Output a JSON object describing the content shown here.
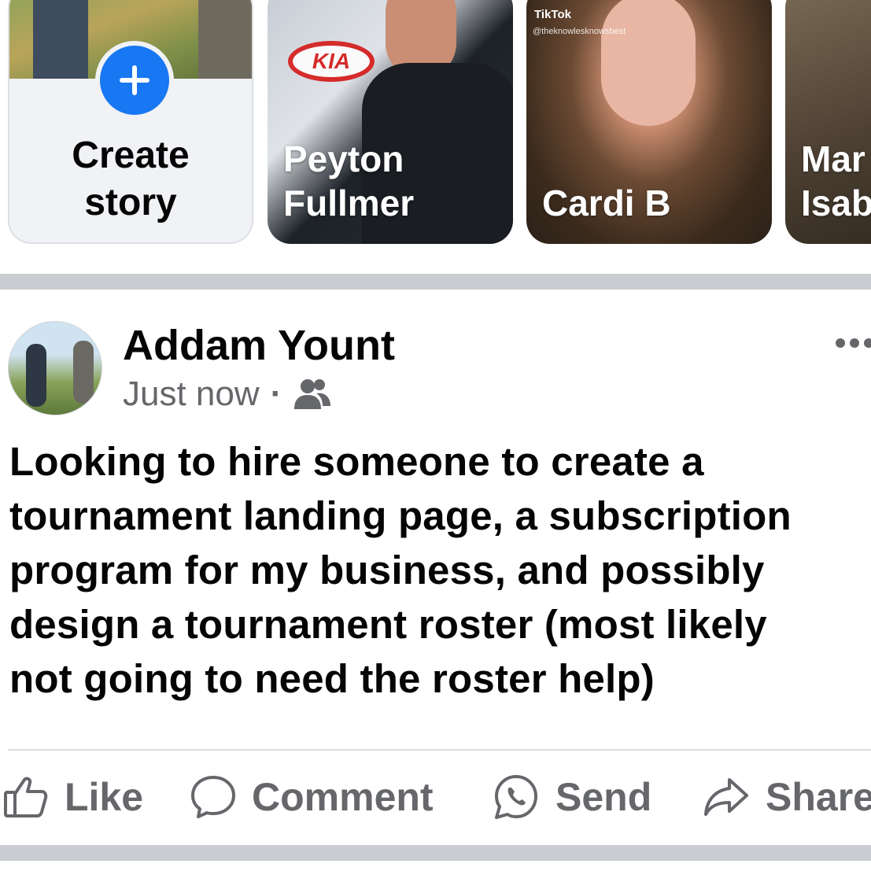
{
  "stories": {
    "create_label": "Create\nstory",
    "items": [
      {
        "name": "Peyton\nFullmer"
      },
      {
        "name": "Cardi B",
        "watermark": "TikTok",
        "watermark_handle": "@theknowlesknowsbest"
      },
      {
        "name": "Mar\nIsab"
      }
    ]
  },
  "post": {
    "author": "Addam Yount",
    "time": "Just now",
    "separator": "·",
    "audience_icon": "friends-icon",
    "body": "Looking to hire someone to create a\ntournament landing page, a subscription\nprogram for my business, and possibly\ndesign a tournament roster (most likely\nnot going to need the roster help)"
  },
  "actions": {
    "like": "Like",
    "comment": "Comment",
    "send": "Send",
    "share": "Share"
  },
  "colors": {
    "accent": "#1877f2",
    "secondary_text": "#65676b",
    "divider": "#c9ccd1"
  }
}
